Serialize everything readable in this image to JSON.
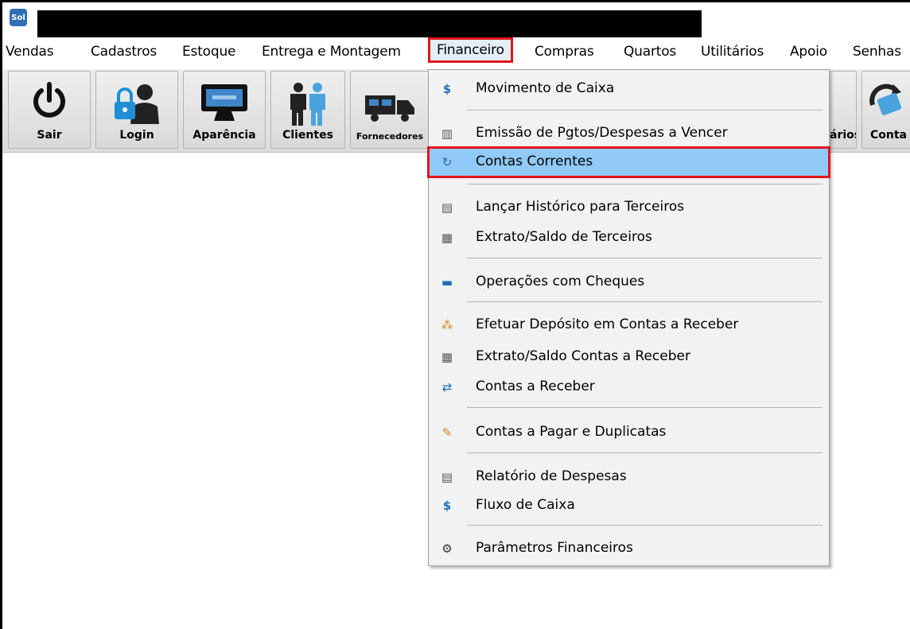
{
  "app": {
    "icon_text": "Sol"
  },
  "menu": {
    "items": [
      "Vendas",
      "Cadastros",
      "Estoque",
      "Entrega e Montagem",
      "Financeiro",
      "Compras",
      "Quartos",
      "Utilitários",
      "Apoio",
      "Senhas"
    ],
    "active": "Financeiro"
  },
  "toolbar": {
    "buttons": [
      {
        "label": "Sair",
        "icon": "power-icon"
      },
      {
        "label": "Login",
        "icon": "lock-user-icon"
      },
      {
        "label": "Aparência",
        "icon": "monitor-icon"
      },
      {
        "label": "Clientes",
        "icon": "people-icon"
      },
      {
        "label": "Fornecedores",
        "icon": "truck-icon"
      },
      {
        "label": "ários",
        "icon": "partial-icon"
      },
      {
        "label": "Conta",
        "icon": "money-refresh-icon"
      }
    ]
  },
  "dropdown": {
    "items": [
      {
        "label": "Movimento de Caixa",
        "icon": "cash-register-icon"
      },
      {
        "label": "Emissão de Pgtos/Despesas a Vencer",
        "icon": "bills-icon"
      },
      {
        "label": "Contas Correntes",
        "icon": "refresh-money-icon",
        "highlighted": true
      },
      {
        "label": "Lançar Histórico para Terceiros",
        "icon": "clipboard-add-icon"
      },
      {
        "label": "Extrato/Saldo de Terceiros",
        "icon": "calculator-icon"
      },
      {
        "label": "Operações com Cheques",
        "icon": "cheque-icon"
      },
      {
        "label": "Efetuar Depósito em Contas a Receber",
        "icon": "deposit-icon"
      },
      {
        "label": "Extrato/Saldo Contas a Receber",
        "icon": "calculator-icon"
      },
      {
        "label": "Contas a Receber",
        "icon": "receive-icon"
      },
      {
        "label": "Contas a Pagar e Duplicatas",
        "icon": "pen-icon"
      },
      {
        "label": "Relatório de Despesas",
        "icon": "report-icon"
      },
      {
        "label": "Fluxo de Caixa",
        "icon": "cash-flow-icon"
      },
      {
        "label": "Parâmetros Financeiros",
        "icon": "gear-money-icon"
      }
    ]
  }
}
